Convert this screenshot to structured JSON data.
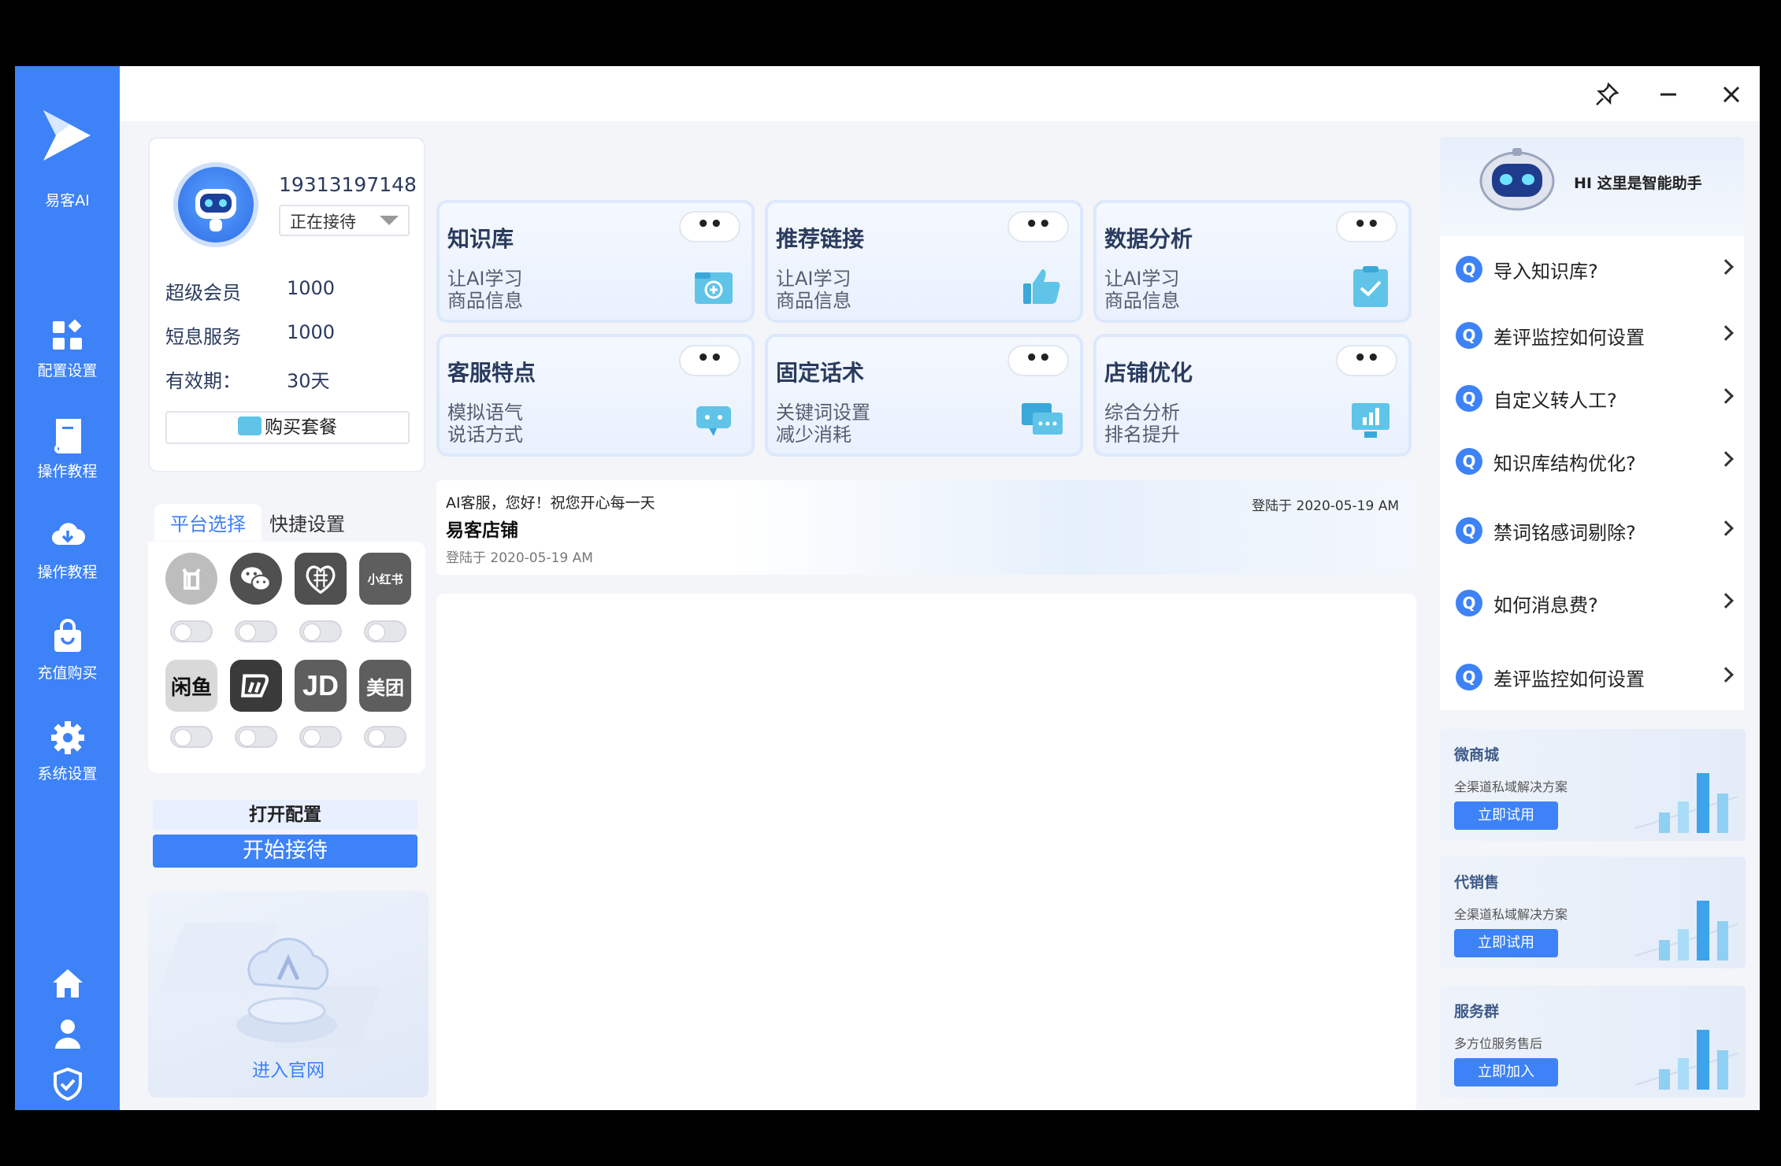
{
  "sidebar": {
    "logo_text": "易客AI",
    "items": [
      {
        "label": "配置设置",
        "icon": "grid-icon"
      },
      {
        "label": "操作教程",
        "icon": "book-icon"
      },
      {
        "label": "操作教程",
        "icon": "cloud-download-icon"
      },
      {
        "label": "充值购买",
        "icon": "shopping-bag-icon"
      },
      {
        "label": "系统设置",
        "icon": "gear-icon"
      }
    ],
    "bottom_icons": [
      "home-icon",
      "user-icon",
      "shield-icon"
    ]
  },
  "titlebar": {
    "icons": [
      "pin-icon",
      "minimize-icon",
      "close-icon"
    ]
  },
  "profile": {
    "phone": "19313197148",
    "status": "正在接待",
    "rows": [
      {
        "label": "超级会员",
        "value": "1000"
      },
      {
        "label": "短息服务",
        "value": "1000"
      },
      {
        "label": "有效期：",
        "value": "30天"
      }
    ],
    "buy_label": "购买套餐"
  },
  "platform": {
    "tabs": [
      "平台选择",
      "快捷设置"
    ],
    "icons": [
      {
        "name": "douyin",
        "label": "",
        "color": "#bdbdbd"
      },
      {
        "name": "wechat",
        "label": "",
        "color": "#505050"
      },
      {
        "name": "pinduoduo",
        "label": "",
        "color": "#505050"
      },
      {
        "name": "xiaohongshu",
        "label": "小红书",
        "color": "#5e5e5e"
      },
      {
        "name": "xianyu",
        "label": "闲鱼",
        "color": "#d9d9d9"
      },
      {
        "name": "dewu",
        "label": "",
        "color": "#3a3a3a"
      },
      {
        "name": "jd",
        "label": "JD",
        "color": "#5e5e5e"
      },
      {
        "name": "meituan",
        "label": "美团",
        "color": "#5e5e5e"
      }
    ],
    "open_config": "打开配置",
    "start": "开始接待"
  },
  "promo": {
    "link": "进入官网"
  },
  "features": [
    {
      "title": "知识库",
      "line1": "让AI学习",
      "line2": "商品信息",
      "more": "••",
      "icon": "knowledge-icon"
    },
    {
      "title": "推荐链接",
      "line1": "让AI学习",
      "line2": "商品信息",
      "more": "••",
      "icon": "thumbs-up-icon"
    },
    {
      "title": "数据分析",
      "line1": "让AI学习",
      "line2": "商品信息",
      "more": "••",
      "icon": "clipboard-check-icon"
    },
    {
      "title": "客服特点",
      "line1": "模拟语气",
      "line2": "说话方式",
      "more": "••",
      "icon": "chat-robot-icon"
    },
    {
      "title": "固定话术",
      "line1": "关键词设置",
      "line2": "减少消耗",
      "more": "••",
      "icon": "message-icon"
    },
    {
      "title": "店铺优化",
      "line1": "综合分析",
      "line2": "排名提升",
      "more": "••",
      "icon": "monitor-chart-icon"
    }
  ],
  "banner": {
    "greeting": "AI客服，您好！祝您开心每一天",
    "shop": "易客店铺",
    "login_left": "登陆于 2020-05-19 AM",
    "login_right": "登陆于 2020-05-19 AM"
  },
  "assistant": {
    "title": "HI 这里是智能助手"
  },
  "faq": [
    {
      "q": "Q",
      "text": "导入知识库?"
    },
    {
      "q": "Q",
      "text": "差评监控如何设置"
    },
    {
      "q": "Q",
      "text": "自定义转人工?"
    },
    {
      "q": "Q",
      "text": "知识库结构优化?"
    },
    {
      "q": "Q",
      "text": "禁词铭感词剔除?"
    },
    {
      "q": "Q",
      "text": "如何消息费?"
    },
    {
      "q": "Q",
      "text": "差评监控如何设置"
    }
  ],
  "services": [
    {
      "title": "微商城",
      "desc": "全渠道私域解决方案",
      "button": "立即试用"
    },
    {
      "title": "代销售",
      "desc": "全渠道私域解决方案",
      "button": "立即试用"
    },
    {
      "title": "服务群",
      "desc": "多方位服务售后",
      "button": "立即加入"
    }
  ],
  "colors": {
    "accent": "#3d82f6",
    "sidebar": "#3d82f6"
  }
}
